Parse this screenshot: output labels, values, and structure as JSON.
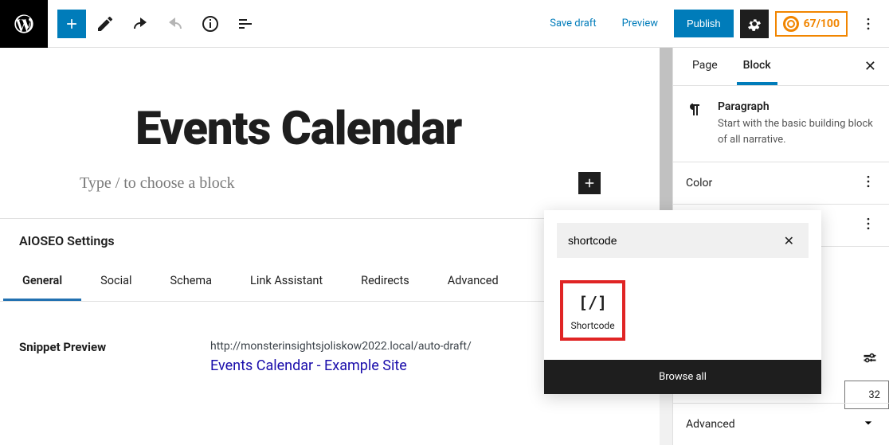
{
  "topbar": {
    "save_draft": "Save draft",
    "preview": "Preview",
    "publish": "Publish",
    "seo_score": "67/100"
  },
  "editor": {
    "post_title": "Events Calendar",
    "paragraph_placeholder": "Type / to choose a block"
  },
  "aioseo": {
    "heading": "AIOSEO Settings",
    "tabs": [
      "General",
      "Social",
      "Schema",
      "Link Assistant",
      "Redirects",
      "Advanced"
    ],
    "snippet_label": "Snippet Preview",
    "snippet_url": "http://monsterinsightsjoliskow2022.local/auto-draft/",
    "snippet_title": "Events Calendar - Example Site"
  },
  "sidebar": {
    "tabs": {
      "page": "Page",
      "block": "Block"
    },
    "block_name": "Paragraph",
    "block_desc": "Start with the basic building block of all narrative.",
    "color": "Color",
    "advanced": "Advanced",
    "input_value": "32"
  },
  "inserter": {
    "search_value": "shortcode",
    "result_label": "Shortcode",
    "result_icon": "[/]",
    "browse_all": "Browse all"
  }
}
